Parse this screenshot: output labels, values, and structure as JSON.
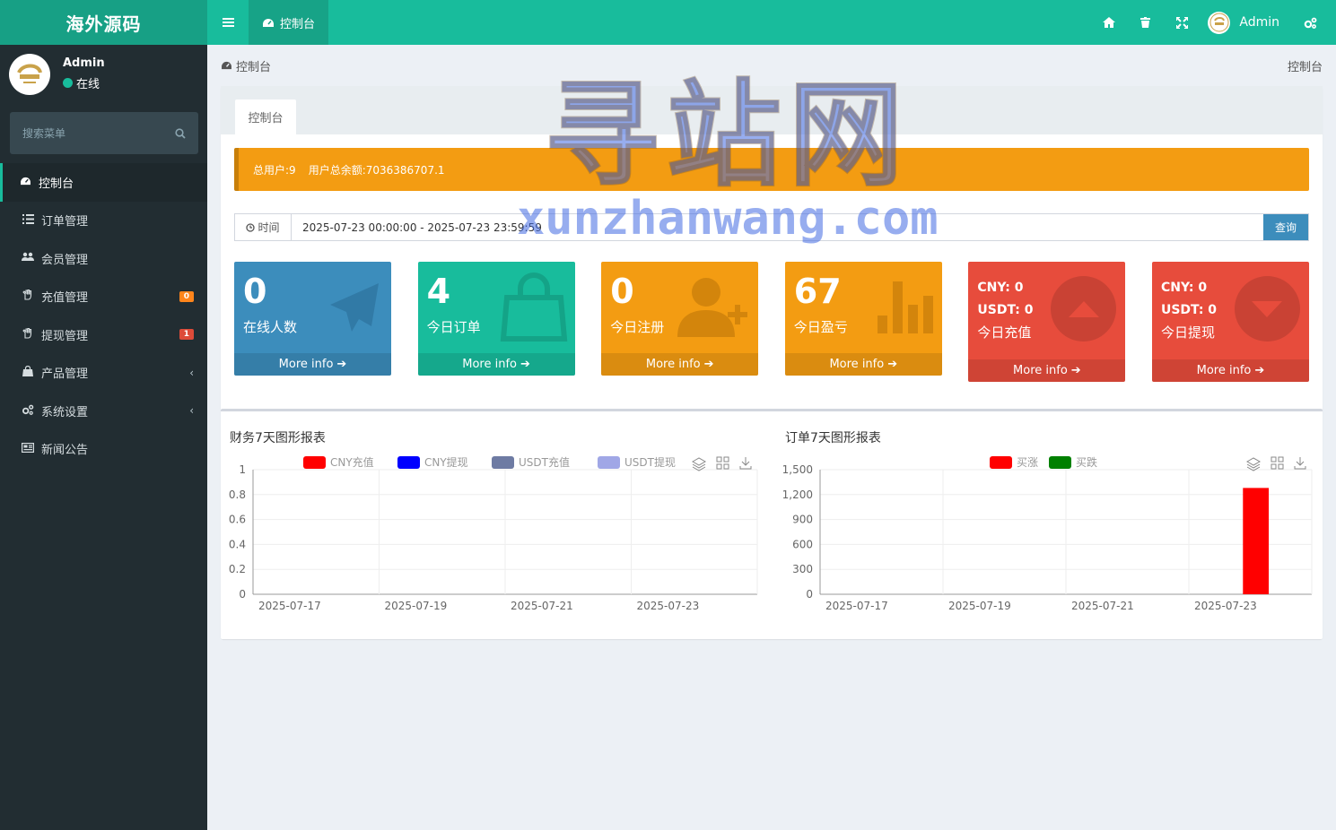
{
  "app": {
    "title": "海外源码"
  },
  "header": {
    "active_tab": "控制台",
    "user_name": "Admin"
  },
  "sidebar": {
    "user_name": "Admin",
    "status": "在线",
    "search_placeholder": "搜索菜单",
    "items": [
      {
        "label": "控制台",
        "icon": "dashboard-icon",
        "active": true
      },
      {
        "label": "订单管理",
        "icon": "list-icon"
      },
      {
        "label": "会员管理",
        "icon": "users-icon"
      },
      {
        "label": "充值管理",
        "icon": "hand-icon",
        "badge": "0",
        "badge_color": "#ff851b"
      },
      {
        "label": "提现管理",
        "icon": "hand-icon",
        "badge": "1",
        "badge_color": "#dd4b39"
      },
      {
        "label": "产品管理",
        "icon": "bag-icon",
        "chevron": true
      },
      {
        "label": "系统设置",
        "icon": "cogs-icon",
        "chevron": true
      },
      {
        "label": "新闻公告",
        "icon": "newspaper-icon"
      }
    ]
  },
  "breadcrumb": {
    "left": "控制台",
    "right": "控制台"
  },
  "panel": {
    "tab": "控制台"
  },
  "callout": {
    "total_users": "总用户:9",
    "balance": "用户总余额:7036386707.1"
  },
  "filter": {
    "label": "时间",
    "value": "2025-07-23 00:00:00 - 2025-07-23 23:59:59",
    "button": "查询"
  },
  "cards": [
    {
      "num": "0",
      "label": "在线人数",
      "more": "More info",
      "color": "#3c8dbc"
    },
    {
      "num": "4",
      "label": "今日订单",
      "more": "More info",
      "color": "#18bc9c"
    },
    {
      "num": "0",
      "label": "今日注册",
      "more": "More info",
      "color": "#f39c12"
    },
    {
      "num": "67",
      "label": "今日盈亏",
      "more": "More info",
      "color": "#f39c12"
    },
    {
      "line1": "CNY:  0",
      "line2": "USDT:  0",
      "line3": "今日充值",
      "more": "More info",
      "color": "#e74c3c"
    },
    {
      "line1": "CNY:  0",
      "line2": "USDT:  0",
      "line3": "今日提现",
      "more": "More info",
      "color": "#e74c3c"
    }
  ],
  "chart_data": [
    {
      "type": "bar",
      "title": "财务7天图形报表",
      "categories": [
        "2025-07-17",
        "2025-07-19",
        "2025-07-21",
        "2025-07-23"
      ],
      "series": [
        {
          "name": "CNY充值",
          "color": "#ff0000",
          "values": [
            0,
            0,
            0,
            0
          ]
        },
        {
          "name": "CNY提现",
          "color": "#0000ff",
          "values": [
            0,
            0,
            0,
            0
          ]
        },
        {
          "name": "USDT充值",
          "color": "#6e7ba3",
          "values": [
            0,
            0,
            0,
            0
          ]
        },
        {
          "name": "USDT提现",
          "color": "#a0a7e6",
          "values": [
            0,
            0,
            0,
            0
          ]
        }
      ],
      "yticks": [
        "0",
        "0.2",
        "0.4",
        "0.6",
        "0.8",
        "1"
      ],
      "ylim": [
        0,
        1
      ],
      "legend": "top-center",
      "grid": true
    },
    {
      "type": "bar",
      "title": "订单7天图形报表",
      "categories": [
        "2025-07-17",
        "2025-07-19",
        "2025-07-21",
        "2025-07-23"
      ],
      "series": [
        {
          "name": "买涨",
          "color": "#ff0000",
          "values": [
            0,
            0,
            0,
            1280
          ]
        },
        {
          "name": "买跌",
          "color": "#008000",
          "values": [
            0,
            0,
            0,
            0
          ]
        }
      ],
      "yticks": [
        "0",
        "300",
        "600",
        "900",
        "1,200",
        "1,500"
      ],
      "ylim": [
        0,
        1500
      ],
      "legend": "top-center",
      "grid": true
    }
  ],
  "watermark": {
    "big": "寻站网",
    "small": "xunzhanwang.com"
  }
}
